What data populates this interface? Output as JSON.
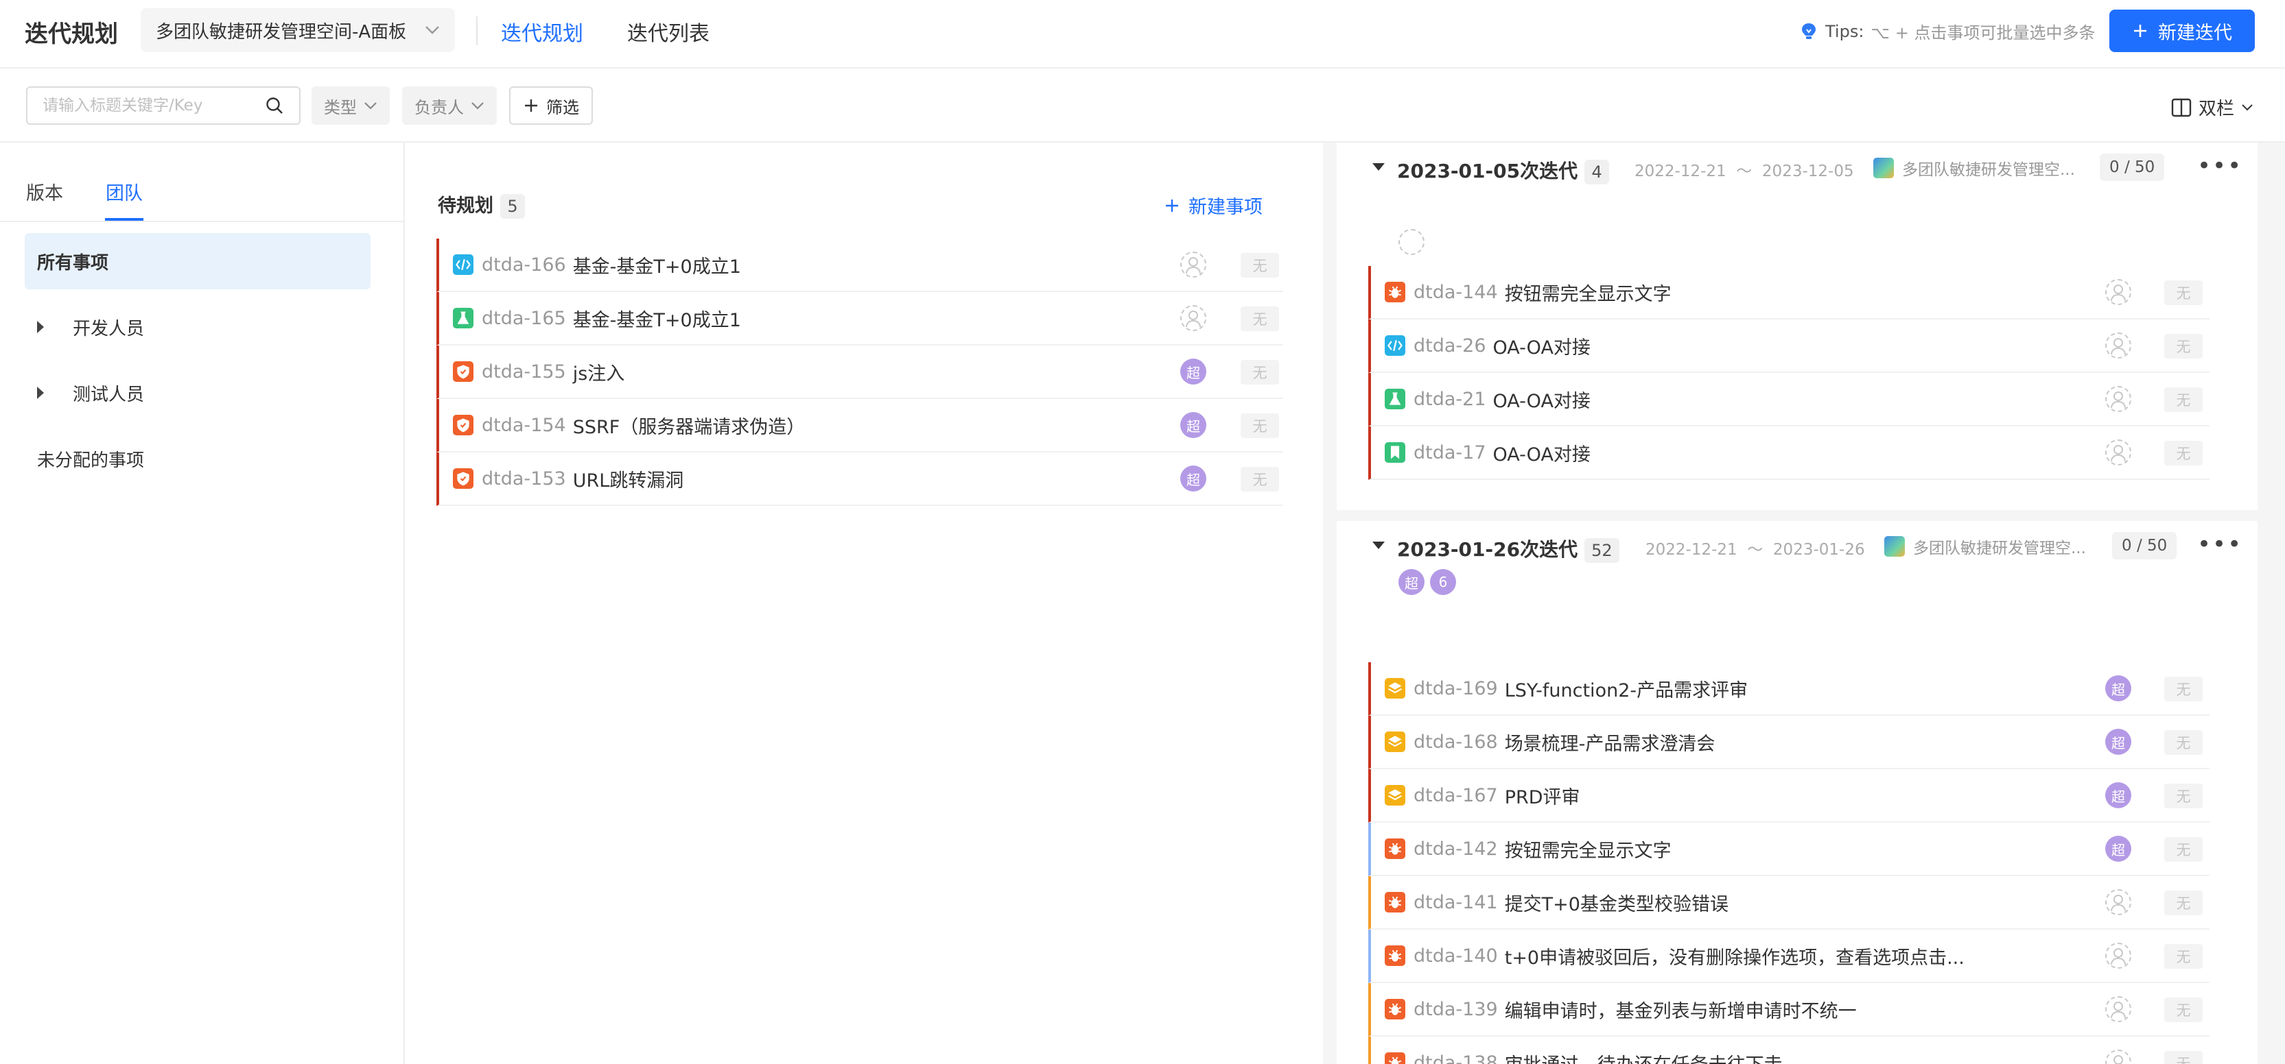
{
  "header": {
    "title": "迭代规划",
    "space": "多团队敏捷研发管理空间-A面板",
    "tabs": [
      {
        "label": "迭代规划",
        "active": true
      },
      {
        "label": "迭代列表",
        "active": false
      }
    ],
    "tips_label": "Tips:",
    "tips_text": "⌥ + 点击事项可批量选中多条",
    "new_iteration": "新建迭代"
  },
  "filters": {
    "search_placeholder": "请输入标题关键字/Key",
    "type": "类型",
    "assignee": "负责人",
    "filter": "筛选",
    "layout": "双栏"
  },
  "sidebar": {
    "tabs": [
      {
        "label": "版本",
        "active": false
      },
      {
        "label": "团队",
        "active": true
      }
    ],
    "items": [
      {
        "label": "所有事项",
        "active": true,
        "expandable": false
      },
      {
        "label": "开发人员",
        "active": false,
        "expandable": true
      },
      {
        "label": "测试人员",
        "active": false,
        "expandable": true
      },
      {
        "label": "未分配的事项",
        "active": false,
        "expandable": false
      }
    ]
  },
  "backlog": {
    "title": "待规划",
    "count": "5",
    "new_item": "新建事项",
    "items": [
      {
        "key": "dtda-166",
        "title": "基金-基金T+0成立1",
        "type": "code",
        "assignee": "",
        "priority": "无"
      },
      {
        "key": "dtda-165",
        "title": "基金-基金T+0成立1",
        "type": "test",
        "assignee": "",
        "priority": "无"
      },
      {
        "key": "dtda-155",
        "title": "js注入",
        "type": "security",
        "assignee": "超",
        "priority": "无"
      },
      {
        "key": "dtda-154",
        "title": "SSRF（服务器端请求伪造）",
        "type": "security",
        "assignee": "超",
        "priority": "无"
      },
      {
        "key": "dtda-153",
        "title": "URL跳转漏洞",
        "type": "security",
        "assignee": "超",
        "priority": "无"
      }
    ]
  },
  "iterations": [
    {
      "name": "2023-01-05次迭代",
      "count": "4",
      "start": "2022-12-21",
      "separator": "～",
      "end": "2023-12-05",
      "space": "多团队敏捷研发管理空...",
      "capacity": "0 / 50",
      "members": [
        ""
      ],
      "items": [
        {
          "key": "dtda-144",
          "title": "按钮需完全显示文字",
          "type": "bug",
          "assignee": "",
          "priority": "无",
          "bar": "#c8331e"
        },
        {
          "key": "dtda-26",
          "title": "OA-OA对接",
          "type": "code",
          "assignee": "",
          "priority": "无",
          "bar": "#c8331e"
        },
        {
          "key": "dtda-21",
          "title": "OA-OA对接",
          "type": "test",
          "assignee": "",
          "priority": "无",
          "bar": "#c8331e"
        },
        {
          "key": "dtda-17",
          "title": "OA-OA对接",
          "type": "bookmark",
          "assignee": "",
          "priority": "无",
          "bar": "#c8331e"
        }
      ]
    },
    {
      "name": "2023-01-26次迭代",
      "count": "52",
      "start": "2022-12-21",
      "separator": "～",
      "end": "2023-01-26",
      "space": "多团队敏捷研发管理空...",
      "capacity": "0 / 50",
      "members": [
        "超",
        "6"
      ],
      "items": [
        {
          "key": "dtda-169",
          "title": "LSY-function2-产品需求评审",
          "type": "story",
          "assignee": "超",
          "priority": "无",
          "bar": "#c8331e"
        },
        {
          "key": "dtda-168",
          "title": "场景梳理-产品需求澄清会",
          "type": "story",
          "assignee": "超",
          "priority": "无",
          "bar": "#c8331e"
        },
        {
          "key": "dtda-167",
          "title": "PRD评审",
          "type": "story",
          "assignee": "超",
          "priority": "无",
          "bar": "#c8331e"
        },
        {
          "key": "dtda-142",
          "title": "按钮需完全显示文字",
          "type": "bug",
          "assignee": "超",
          "priority": "无",
          "bar": "#8fb4f5"
        },
        {
          "key": "dtda-141",
          "title": "提交T+0基金类型校验错误",
          "type": "bug",
          "assignee": "",
          "priority": "无",
          "bar": "#f39b2b"
        },
        {
          "key": "dtda-140",
          "title": "t+0申请被驳回后，没有删除操作选项，查看选项点击...",
          "type": "bug",
          "assignee": "",
          "priority": "无",
          "bar": "#8fb4f5"
        },
        {
          "key": "dtda-139",
          "title": "编辑申请时，基金列表与新增申请时不统一",
          "type": "bug",
          "assignee": "",
          "priority": "无",
          "bar": "#f39b2b"
        },
        {
          "key": "dtda-138",
          "title": "审批通过，待办还在任务未往下走",
          "type": "bug",
          "assignee": "",
          "priority": "无",
          "bar": "#f39b2b"
        }
      ]
    }
  ],
  "colors": {
    "accent": "#1f6fff",
    "code_icon": "#26b2e8",
    "test_icon": "#35c27a",
    "security_icon": "#f0602a",
    "bug_icon": "#f0602a",
    "story_icon": "#f5b014",
    "bookmark_icon": "#35c27a",
    "avatar": "#b49ae6"
  }
}
